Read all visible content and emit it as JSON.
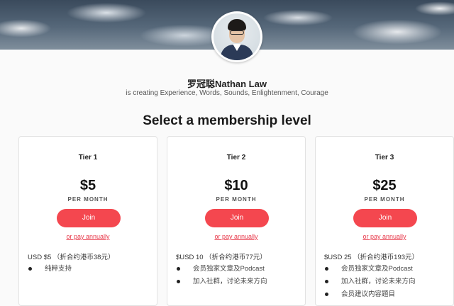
{
  "creator": {
    "name": "罗冠聪Nathan Law",
    "tagline": "is creating Experience, Words, Sounds, Enlightenment, Courage"
  },
  "page": {
    "section_title": "Select a membership level"
  },
  "tiers": [
    {
      "name": "Tier 1",
      "price": "$5",
      "period": "PER MONTH",
      "join_label": "Join",
      "pay_annually": "or pay annually",
      "description": "USD $5 （折合约港币38元）",
      "benefits": [
        "纯粹支持"
      ]
    },
    {
      "name": "Tier 2",
      "price": "$10",
      "period": "PER MONTH",
      "join_label": "Join",
      "pay_annually": "or pay annually",
      "description": "$USD 10 （折合约港币77元）",
      "benefits": [
        "会员独家文章及Podcast",
        "加入社群，讨论未来方向"
      ]
    },
    {
      "name": "Tier 3",
      "price": "$25",
      "period": "PER MONTH",
      "join_label": "Join",
      "pay_annually": "or pay annually",
      "description": "$USD 25 （折合约港币193元）",
      "benefits": [
        "会员独家文章及Podcast",
        "加入社群，讨论未来方向",
        "会员建议内容题目"
      ]
    }
  ],
  "colors": {
    "accent": "#f4474f",
    "link": "#e8394a"
  }
}
